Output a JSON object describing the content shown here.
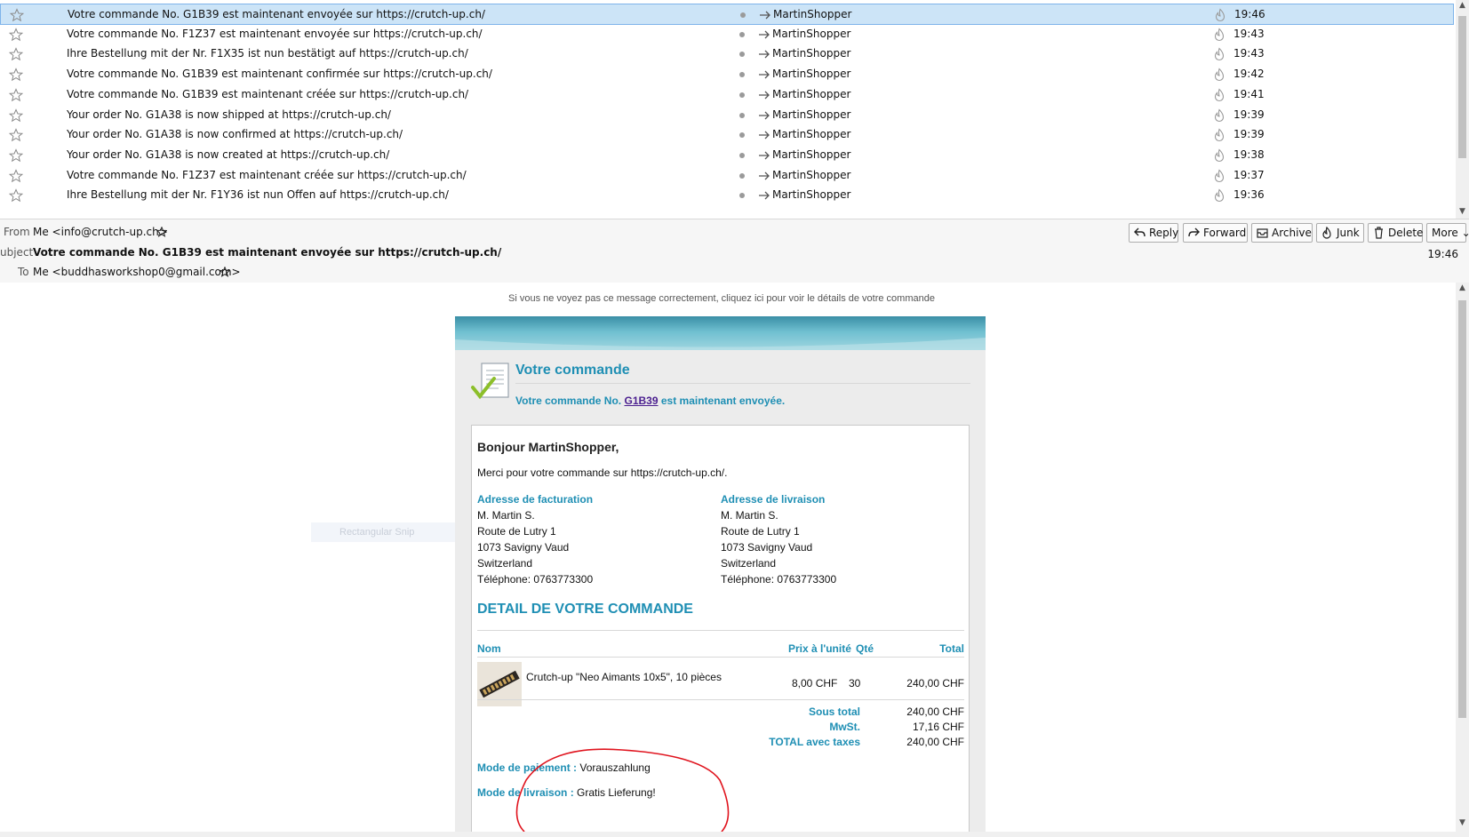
{
  "message_list": [
    {
      "subject": "Votre commande No. G1B39 est maintenant envoyée sur https://crutch-up.ch/",
      "correspondent": "MartinShopper",
      "date": "19:46",
      "selected": true
    },
    {
      "subject": "Votre commande No. F1Z37 est maintenant envoyée sur https://crutch-up.ch/",
      "correspondent": "MartinShopper",
      "date": "19:43",
      "selected": false
    },
    {
      "subject": "Ihre Bestellung mit der Nr. F1X35 ist nun bestätigt auf https://crutch-up.ch/",
      "correspondent": "MartinShopper",
      "date": "19:43",
      "selected": false
    },
    {
      "subject": "Votre commande No. G1B39 est maintenant confirmée sur https://crutch-up.ch/",
      "correspondent": "MartinShopper",
      "date": "19:42",
      "selected": false
    },
    {
      "subject": "Votre commande No. G1B39 est maintenant créée sur https://crutch-up.ch/",
      "correspondent": "MartinShopper",
      "date": "19:41",
      "selected": false
    },
    {
      "subject": "Your order No. G1A38 is now shipped at https://crutch-up.ch/",
      "correspondent": "MartinShopper",
      "date": "19:39",
      "selected": false
    },
    {
      "subject": "Your order No. G1A38 is now confirmed at https://crutch-up.ch/",
      "correspondent": "MartinShopper",
      "date": "19:39",
      "selected": false
    },
    {
      "subject": "Your order No. G1A38 is now created at https://crutch-up.ch/",
      "correspondent": "MartinShopper",
      "date": "19:38",
      "selected": false
    },
    {
      "subject": "Votre commande No. F1Z37 est maintenant créée sur https://crutch-up.ch/",
      "correspondent": "MartinShopper",
      "date": "19:37",
      "selected": false
    },
    {
      "subject": "Ihre Bestellung mit der Nr. F1Y36 ist nun Offen auf https://crutch-up.ch/",
      "correspondent": "MartinShopper",
      "date": "19:36",
      "selected": false
    }
  ],
  "header": {
    "from_label": "From",
    "from_value": "Me <info@crutch-up.ch>",
    "subject_label": "ubject",
    "subject_value": "Votre commande No. G1B39 est maintenant envoyée sur https://crutch-up.ch/",
    "to_label": "To",
    "to_value": "Me <buddhasworkshop0@gmail.com>",
    "date": "19:46",
    "buttons": {
      "reply": "Reply",
      "forward": "Forward",
      "archive": "Archive",
      "junk": "Junk",
      "delete": "Delete",
      "more": "More"
    }
  },
  "email": {
    "top_note": "Si vous ne voyez pas ce message correctement, cliquez ici pour voir le détails de votre commande",
    "title": "Votre commande",
    "status_prefix": "Votre commande No.",
    "order_no": "G1B39",
    "status_suffix": "est maintenant envoyée.",
    "greeting": "Bonjour MartinShopper,",
    "thanks": "Merci pour votre commande sur https://crutch-up.ch/.",
    "billing": {
      "label": "Adresse de facturation",
      "name": "M. Martin S.",
      "street": "Route de Lutry 1",
      "city": "1073 Savigny Vaud",
      "country": "Switzerland",
      "phone": "Téléphone: 0763773300"
    },
    "shipping": {
      "label": "Adresse de livraison",
      "name": "M. Martin S.",
      "street": "Route de Lutry 1",
      "city": "1073 Savigny Vaud",
      "country": "Switzerland",
      "phone": "Téléphone: 0763773300"
    },
    "detail_title": "DETAIL DE VOTRE COMMANDE",
    "columns": {
      "name": "Nom",
      "unit_price": "Prix à l'unité",
      "qty": "Qté",
      "total": "Total"
    },
    "item": {
      "name": "Crutch-up \"Neo Aimants 10x5\", 10 pièces",
      "unit_price": "8,00 CHF",
      "qty": "30",
      "total": "240,00 CHF"
    },
    "totals": {
      "subtotal_label": "Sous total",
      "subtotal": "240,00 CHF",
      "tax_label": "MwSt.",
      "tax": "17,16 CHF",
      "grand_label": "TOTAL avec taxes",
      "grand": "240,00 CHF"
    },
    "payment_label": "Mode de paiement :",
    "payment_value": "Vorauszahlung",
    "delivery_label": "Mode de livraison :",
    "delivery_value": "Gratis Lieferung!"
  },
  "overlay": {
    "snip_label": "Rectangular Snip"
  }
}
